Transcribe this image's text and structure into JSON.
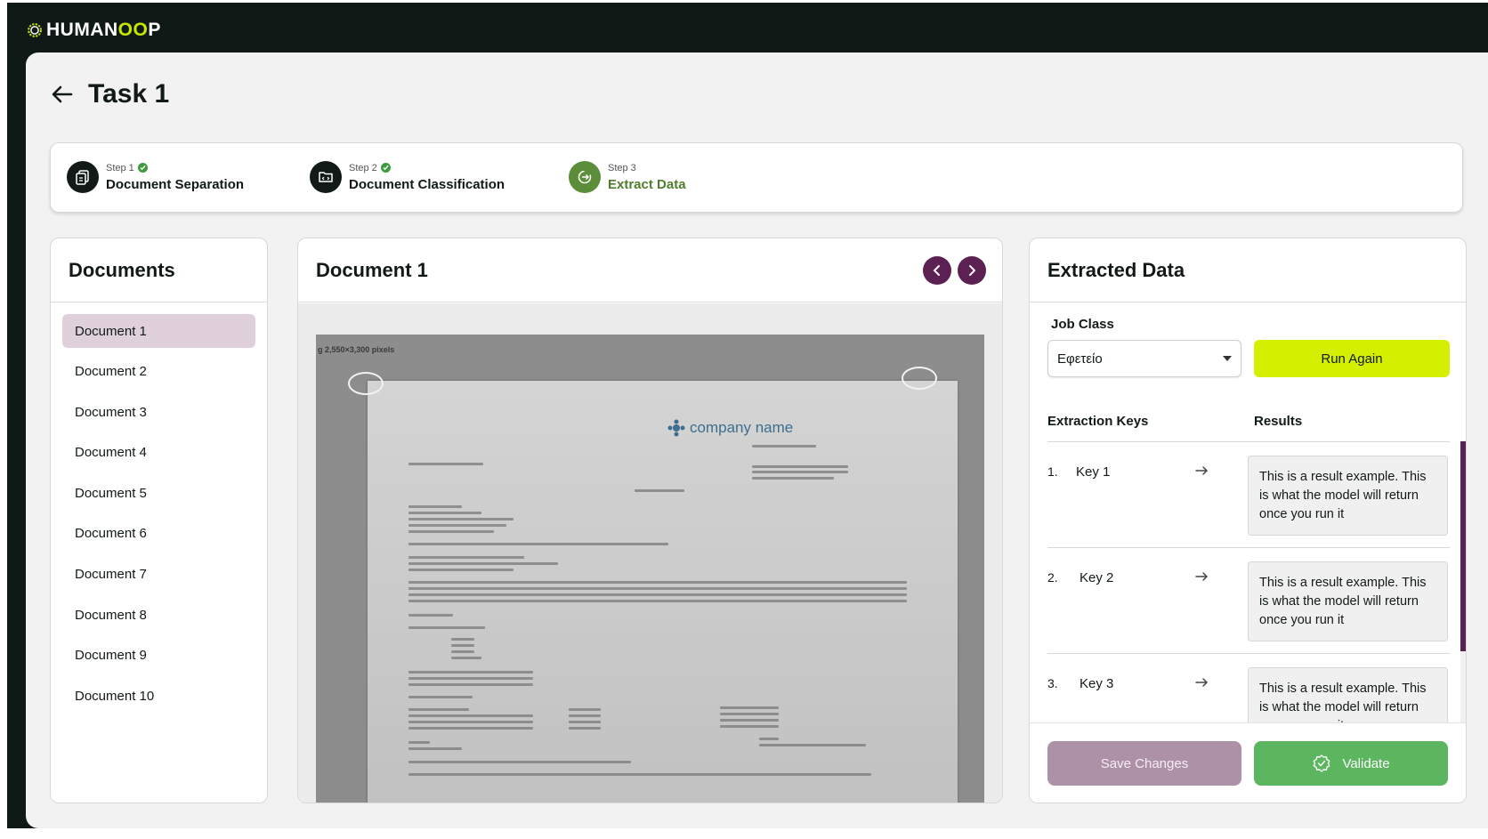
{
  "brand": {
    "logo_text_pre": "HUMAN",
    "logo_text_oo": "OO",
    "logo_text_post": "P",
    "accent_color": "#d4ef00",
    "primary_color": "#5b2152"
  },
  "page": {
    "title": "Task 1"
  },
  "stepper": {
    "steps": [
      {
        "small": "Step 1",
        "name": "Document Separation",
        "done": true,
        "icon": "documents-icon"
      },
      {
        "small": "Step 2",
        "name": "Document Classification",
        "done": true,
        "icon": "folder-classify-icon"
      },
      {
        "small": "Step 3",
        "name": "Extract Data",
        "done": false,
        "active": true,
        "icon": "extract-icon"
      }
    ]
  },
  "documents": {
    "title": "Documents",
    "items": [
      "Document 1",
      "Document 2",
      "Document 3",
      "Document 4",
      "Document 5",
      "Document 6",
      "Document 7",
      "Document 8",
      "Document 9",
      "Document 10"
    ],
    "selected": "Document 1"
  },
  "viewer": {
    "title": "Document 1",
    "image_caption": "g 2,550×3,300 pixels",
    "paper_logo": "company name"
  },
  "extracted": {
    "title": "Extracted Data",
    "job_class_label": "Job Class",
    "job_class_value": "Εφετείο",
    "run_again_label": "Run Again",
    "keys_header": "Extraction Keys",
    "results_header": "Results",
    "rows": [
      {
        "num": "1.",
        "key": "Key 1",
        "result": "This is a result example. This is what the model will return once you run it"
      },
      {
        "num": "2.",
        "key": "Key 2",
        "result": "This is a result example. This is what the model will return once you run it"
      },
      {
        "num": "3.",
        "key": "Key 3",
        "result": "This is a result example. This is what the model will return once you run it"
      }
    ],
    "save_label": "Save Changes",
    "validate_label": "Validate"
  }
}
